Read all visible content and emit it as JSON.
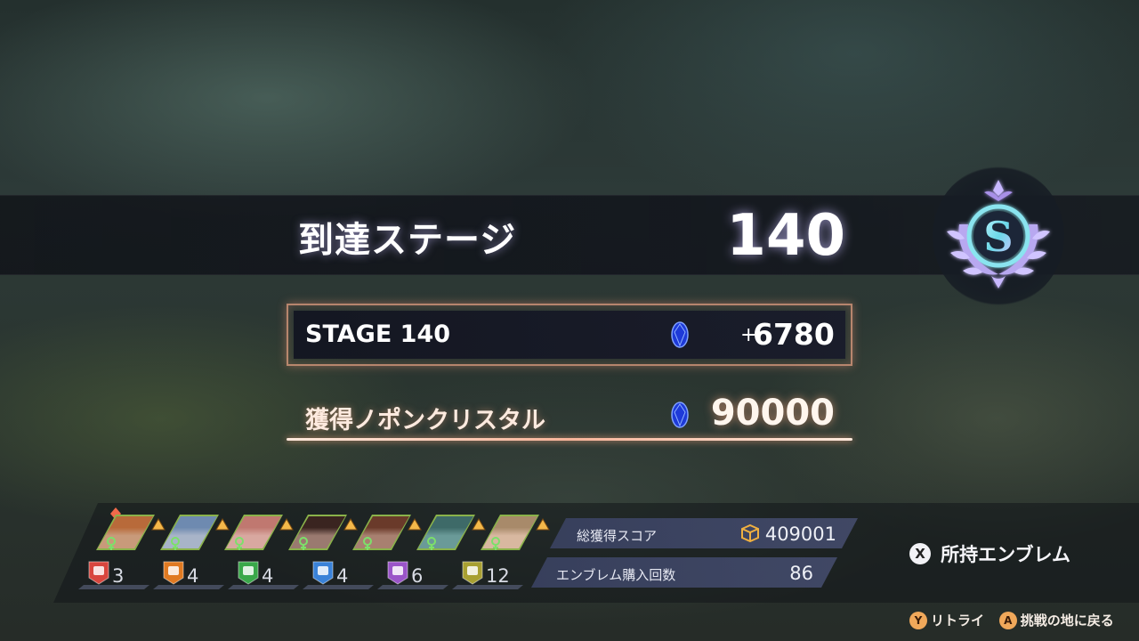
{
  "result": {
    "stage_label": "到達ステージ",
    "stage_value": "140",
    "rank": "S"
  },
  "stage_bonus": {
    "label": "STAGE 140",
    "plus": "+",
    "value": "6780"
  },
  "total": {
    "label": "獲得ノポンクリスタル",
    "value": "90000"
  },
  "party": {
    "members": [
      {
        "hair": "#b86a3a",
        "bg": "#c89a7a"
      },
      {
        "hair": "#6e8ab0",
        "bg": "#a8b4c8"
      },
      {
        "hair": "#c07870",
        "bg": "#d8a8a0"
      },
      {
        "hair": "#3a2420",
        "bg": "#9a7a70"
      },
      {
        "hair": "#6a3a2a",
        "bg": "#a88070"
      },
      {
        "hair": "#3e6a68",
        "bg": "#6a9a98"
      },
      {
        "hair": "#a88a6a",
        "bg": "#d8b8a0"
      }
    ]
  },
  "emblems": [
    {
      "color": "#d8463e",
      "icon": "compass-icon",
      "count": "3"
    },
    {
      "color": "#e07a22",
      "icon": "triangle-icon",
      "count": "4"
    },
    {
      "color": "#3aa84a",
      "icon": "stripes-icon",
      "count": "4"
    },
    {
      "color": "#3a82d8",
      "icon": "dots-icon",
      "count": "4"
    },
    {
      "color": "#9a54c8",
      "icon": "home-icon",
      "count": "6"
    },
    {
      "color": "#a8a032",
      "icon": "star-icon",
      "count": "12"
    }
  ],
  "stats": {
    "score_label": "総獲得スコア",
    "score_value": "409001",
    "purchase_label": "エンブレム購入回数",
    "purchase_value": "86"
  },
  "buttons": {
    "emblems_key": "X",
    "emblems_label": "所持エンブレム",
    "retry_key": "Y",
    "retry_label": "リトライ",
    "back_key": "A",
    "back_label": "挑戦の地に戻る"
  }
}
